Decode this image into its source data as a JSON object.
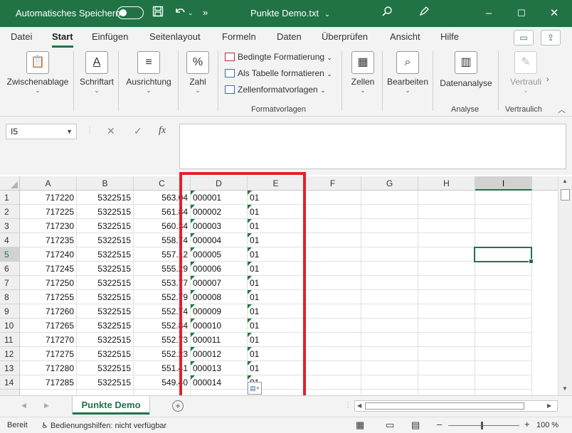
{
  "titlebar": {
    "autosave_label": "Automatisches Speichern",
    "autosave_state": "off",
    "doc_title": "Punkte Demo.txt",
    "title_chevron": "⌄",
    "save_icon": "save-icon",
    "undo_icon": "undo-icon",
    "more_icon": "»",
    "minimize": "–",
    "maximize": "☐",
    "close": "✕"
  },
  "tabs": [
    "Datei",
    "Start",
    "Einfügen",
    "Seitenlayout",
    "Formeln",
    "Daten",
    "Überprüfen",
    "Ansicht",
    "Hilfe"
  ],
  "active_tab": "Start",
  "ribbon": {
    "clipboard": "Zwischenablage",
    "font": "Schriftart",
    "alignment": "Ausrichtung",
    "number": "Zahl",
    "number_icon": "%",
    "conditional_formatting": "Bedingte Formatierung",
    "format_as_table": "Als Tabelle formatieren",
    "cell_styles": "Zellenformatvorlagen",
    "styles_group": "Formatvorlagen",
    "cells": "Zellen",
    "editing": "Bearbeiten",
    "data_analysis": "Datenanalyse",
    "analysis_group": "Analyse",
    "sensitivity": "Vertrauli",
    "sensitivity_group": "Vertraulich"
  },
  "formula_bar": {
    "name_box": "I5",
    "cancel": "✕",
    "enter": "✓",
    "fx": "fx",
    "content": ""
  },
  "columns": [
    "A",
    "B",
    "C",
    "D",
    "E",
    "F",
    "G",
    "H",
    "I"
  ],
  "selected_column": "I",
  "selected_row": "5",
  "rows": [
    {
      "n": "1",
      "a": "717220",
      "b": "5322515",
      "c": "563.04",
      "d": "000001",
      "e": "01"
    },
    {
      "n": "2",
      "a": "717225",
      "b": "5322515",
      "c": "561.84",
      "d": "000002",
      "e": "01"
    },
    {
      "n": "3",
      "a": "717230",
      "b": "5322515",
      "c": "560.34",
      "d": "000003",
      "e": "01"
    },
    {
      "n": "4",
      "a": "717235",
      "b": "5322515",
      "c": "558.74",
      "d": "000004",
      "e": "01"
    },
    {
      "n": "5",
      "a": "717240",
      "b": "5322515",
      "c": "557.12",
      "d": "000005",
      "e": "01"
    },
    {
      "n": "6",
      "a": "717245",
      "b": "5322515",
      "c": "555.29",
      "d": "000006",
      "e": "01"
    },
    {
      "n": "7",
      "a": "717250",
      "b": "5322515",
      "c": "553.77",
      "d": "000007",
      "e": "01"
    },
    {
      "n": "8",
      "a": "717255",
      "b": "5322515",
      "c": "552.79",
      "d": "000008",
      "e": "01"
    },
    {
      "n": "9",
      "a": "717260",
      "b": "5322515",
      "c": "552.74",
      "d": "000009",
      "e": "01"
    },
    {
      "n": "10",
      "a": "717265",
      "b": "5322515",
      "c": "552.84",
      "d": "000010",
      "e": "01"
    },
    {
      "n": "11",
      "a": "717270",
      "b": "5322515",
      "c": "552.73",
      "d": "000011",
      "e": "01"
    },
    {
      "n": "12",
      "a": "717275",
      "b": "5322515",
      "c": "552.23",
      "d": "000012",
      "e": "01"
    },
    {
      "n": "13",
      "a": "717280",
      "b": "5322515",
      "c": "551.41",
      "d": "000013",
      "e": "01"
    },
    {
      "n": "14",
      "a": "717285",
      "b": "5322515",
      "c": "549.40",
      "d": "000014",
      "e": "01"
    }
  ],
  "sheets": [
    "Punkte Demo"
  ],
  "statusbar": {
    "mode": "Bereit",
    "accessibility": "Bedienungshilfen: nicht verfügbar",
    "zoom": "100 %",
    "zoom_minus": "–",
    "zoom_plus": "+"
  },
  "colors": {
    "excel_green": "#217346",
    "highlight_red": "#e3202c"
  }
}
